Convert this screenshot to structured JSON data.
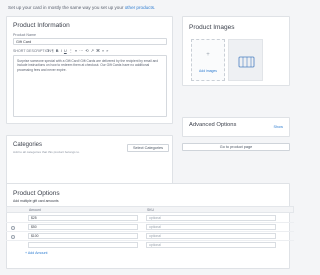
{
  "intro": {
    "text": "Set up your card in mostly the same way you set up your ",
    "link": "other products."
  },
  "product_info": {
    "title": "Product Information",
    "name_label": "Product Name",
    "name_value": "Gift Card",
    "desc_label": "SHORT DESCRIPTION",
    "toolbar": [
      "T",
      "¶",
      "B",
      "I",
      "U",
      "⋮",
      "≡",
      "⋯",
      "⟲",
      "↗",
      "⌘",
      "«",
      "»"
    ],
    "description": "Surprise someone special with a Gift Card! Gift Cards are delivered by the recipient by email and include instructions on how to redeem them at checkout. Our Gift Cards have no additional processing fees and never expire."
  },
  "product_images": {
    "title": "Product Images",
    "add_label": "Add images"
  },
  "advanced": {
    "title": "Advanced Options",
    "show_label": "Show",
    "goto_label": "Go to product page"
  },
  "categories": {
    "title": "Categories",
    "subtitle": "Add to all categories that this product belongs to.",
    "button": "Select Categories"
  },
  "product_options": {
    "title": "Product Options",
    "subtitle": "Add multiple gift card amounts",
    "columns": [
      "Amount",
      "SKU"
    ],
    "rows": [
      {
        "amount": "$25",
        "sku": "optional"
      },
      {
        "amount": "$50",
        "sku": "optional"
      },
      {
        "amount": "$100",
        "sku": "optional"
      },
      {
        "amount": "",
        "sku": "optional"
      }
    ],
    "add_amount": "+ Add Amount"
  }
}
